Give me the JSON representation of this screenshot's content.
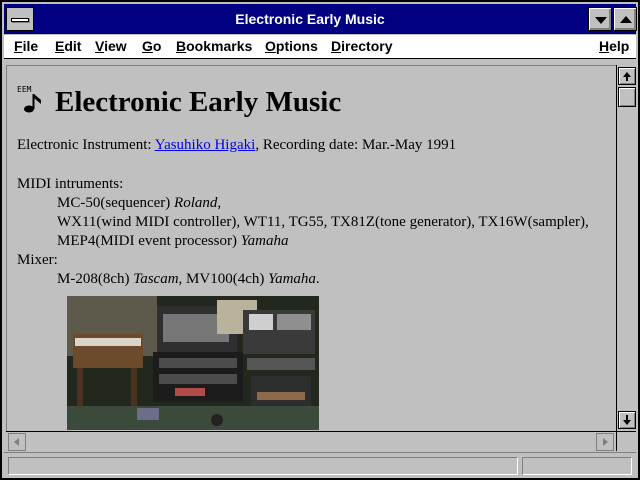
{
  "window": {
    "title": "Electronic Early Music"
  },
  "menubar": {
    "items": [
      "File",
      "Edit",
      "View",
      "Go",
      "Bookmarks",
      "Options",
      "Directory"
    ],
    "help": "Help"
  },
  "document": {
    "icon_label": "EEM",
    "heading": "Electronic Early Music",
    "line1": {
      "prefix": "Electronic Instrument: ",
      "link": "Yasuhiko Higaki",
      "suffix": ", Recording date: Mar.-May 1991"
    },
    "midi_label": "MIDI intruments:",
    "midi_items": [
      {
        "text": "MC-50(sequencer) ",
        "maker": "Roland",
        "tail": ","
      },
      {
        "text": "WX11(wind MIDI controller), WT11, TG55, TX81Z(tone generator), TX16W(sampler),",
        "maker": "",
        "tail": ""
      },
      {
        "text": "MEP4(MIDI event processor) ",
        "maker": "Yamaha",
        "tail": ""
      }
    ],
    "mixer_label": "Mixer:",
    "mixer_line": {
      "a": "M-208(8ch) ",
      "a_maker": "Tascam",
      "b": ", MV100(4ch) ",
      "b_maker": "Yamaha",
      "tail": "."
    }
  },
  "colors": {
    "titlebar": "#000080",
    "background": "#c0c0c0",
    "link": "#0000ee"
  }
}
